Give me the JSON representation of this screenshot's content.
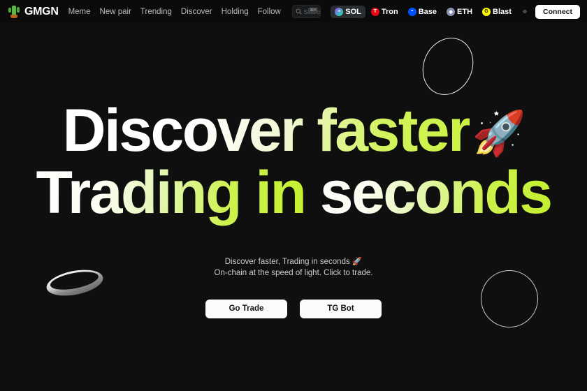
{
  "header": {
    "brand": {
      "name": "GMGN",
      "logo_icon": "cactus-icon"
    },
    "nav": [
      {
        "label": "Meme"
      },
      {
        "label": "New pair"
      },
      {
        "label": "Trending"
      },
      {
        "label": "Discover"
      },
      {
        "label": "Holding"
      },
      {
        "label": "Follow"
      }
    ],
    "search": {
      "placeholder": "Search token/co",
      "shortcut": "⌘K",
      "icon": "search-icon"
    },
    "chains": [
      {
        "label": "SOL",
        "active": true,
        "color": "#9945ff",
        "glyph": "≡"
      },
      {
        "label": "Tron",
        "active": false,
        "color": "#e50915",
        "glyph": "T"
      },
      {
        "label": "Base",
        "active": false,
        "color": "#0052ff",
        "glyph": "◓"
      },
      {
        "label": "ETH",
        "active": false,
        "color": "#8a92b2",
        "glyph": "◆"
      },
      {
        "label": "Blast",
        "active": false,
        "color": "#fcfc03",
        "glyph": "G"
      }
    ],
    "settings_icon": "settings-target-icon",
    "connect_label": "Connect"
  },
  "hero": {
    "headline_line1": "Discover faster",
    "headline_rocket": "🚀",
    "headline_line2_white": "Trading in",
    "headline_line2_green": " seconds",
    "subtitle_line1": "Discover faster, Trading in seconds 🚀",
    "subtitle_line2": "On-chain at the speed of light. Click to trade.",
    "cta_primary": "Go Trade",
    "cta_secondary": "TG Bot"
  },
  "decor": {
    "ring_top": "ellipse-ring-decoration",
    "ring_bottom": "circle-ring-decoration",
    "disc": "coin-disc-decoration"
  },
  "theme": {
    "background": "#0f0f0f",
    "header_background": "#0b0b0b",
    "accent_green": "#caf23f",
    "text_primary": "#ffffff",
    "text_muted": "#b9bcbd"
  }
}
